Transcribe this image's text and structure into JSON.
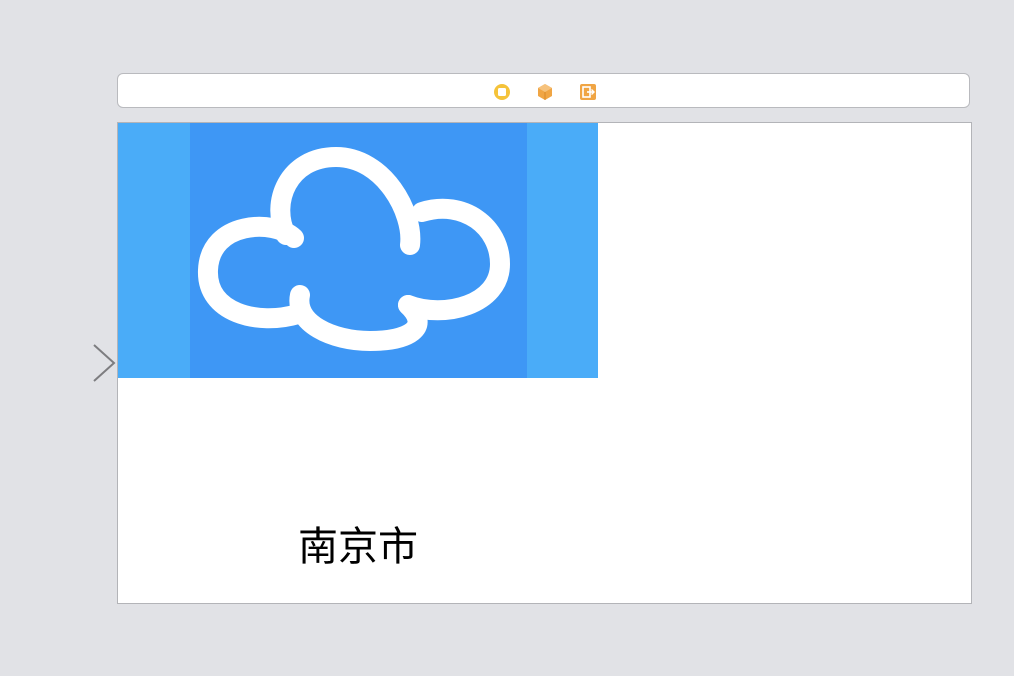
{
  "scene_dock": {
    "icons": [
      "view-controller-icon",
      "first-responder-icon",
      "exit-icon"
    ],
    "colors": {
      "view_controller": "#f5c33a",
      "first_responder": "#f0a544",
      "exit": "#f0a544"
    }
  },
  "storyboard": {
    "entry_point": "entry-point-arrow-icon"
  },
  "view": {
    "image": {
      "icon": "cloud-icon",
      "colors": {
        "background": "#4aacf8",
        "panel": "#3e97f5",
        "cloud": "#ffffff"
      }
    },
    "city_label": "南京市"
  }
}
